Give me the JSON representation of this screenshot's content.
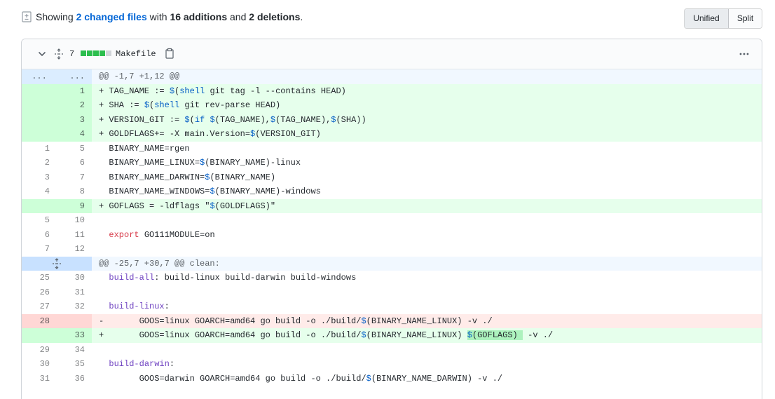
{
  "summary": {
    "showing": "Showing",
    "files_link": "2 changed files",
    "with": "with",
    "additions": "16 additions",
    "and": "and",
    "deletions": "2 deletions",
    "period": "."
  },
  "view_toggle": {
    "unified": "Unified",
    "split": "Split"
  },
  "file": {
    "change_count": "7",
    "name": "Makefile",
    "diffstat": {
      "added_blocks": 4,
      "neutral_blocks": 1
    }
  },
  "hunks": [
    {
      "header": "@@ -1,7 +1,12 @@",
      "left_marker": "...",
      "right_marker": "...",
      "lines": [
        {
          "type": "add",
          "old": "",
          "new": "1",
          "sign": "+",
          "code": "TAG_NAME := $(shell git tag -l --contains HEAD)"
        },
        {
          "type": "add",
          "old": "",
          "new": "2",
          "sign": "+",
          "code": "SHA := $(shell git rev-parse HEAD)"
        },
        {
          "type": "add",
          "old": "",
          "new": "3",
          "sign": "+",
          "code": "VERSION_GIT := $(if $(TAG_NAME),$(TAG_NAME),$(SHA))"
        },
        {
          "type": "add",
          "old": "",
          "new": "4",
          "sign": "+",
          "code": "GOLDFLAGS+= -X main.Version=$(VERSION_GIT)"
        },
        {
          "type": "ctx",
          "old": "1",
          "new": "5",
          "sign": " ",
          "code": "BINARY_NAME=rgen"
        },
        {
          "type": "ctx",
          "old": "2",
          "new": "6",
          "sign": " ",
          "code": "BINARY_NAME_LINUX=$(BINARY_NAME)-linux"
        },
        {
          "type": "ctx",
          "old": "3",
          "new": "7",
          "sign": " ",
          "code": "BINARY_NAME_DARWIN=$(BINARY_NAME)"
        },
        {
          "type": "ctx",
          "old": "4",
          "new": "8",
          "sign": " ",
          "code": "BINARY_NAME_WINDOWS=$(BINARY_NAME)-windows"
        },
        {
          "type": "add",
          "old": "",
          "new": "9",
          "sign": "+",
          "code": "GOFLAGS = -ldflags \"$(GOLDFLAGS)\""
        },
        {
          "type": "ctx",
          "old": "5",
          "new": "10",
          "sign": " ",
          "code": ""
        },
        {
          "type": "ctx",
          "old": "6",
          "new": "11",
          "sign": " ",
          "code": "export GO111MODULE=on"
        },
        {
          "type": "ctx",
          "old": "7",
          "new": "12",
          "sign": " ",
          "code": ""
        }
      ]
    },
    {
      "header": "@@ -25,7 +30,7 @@ clean:",
      "lines": [
        {
          "type": "ctx",
          "old": "25",
          "new": "30",
          "sign": " ",
          "code": "build-all: build-linux build-darwin build-windows"
        },
        {
          "type": "ctx",
          "old": "26",
          "new": "31",
          "sign": " ",
          "code": ""
        },
        {
          "type": "ctx",
          "old": "27",
          "new": "32",
          "sign": " ",
          "code": "build-linux:"
        },
        {
          "type": "del",
          "old": "28",
          "new": "",
          "sign": "-",
          "code": "\tGOOS=linux GOARCH=amd64 go build -o ./build/$(BINARY_NAME_LINUX) -v ./"
        },
        {
          "type": "add",
          "old": "",
          "new": "33",
          "sign": "+",
          "code": "\tGOOS=linux GOARCH=amd64 go build -o ./build/$(BINARY_NAME_LINUX) $(GOFLAGS) -v ./"
        },
        {
          "type": "ctx",
          "old": "29",
          "new": "34",
          "sign": " ",
          "code": ""
        },
        {
          "type": "ctx",
          "old": "30",
          "new": "35",
          "sign": " ",
          "code": "build-darwin:"
        },
        {
          "type": "ctx",
          "old": "31",
          "new": "36",
          "sign": " ",
          "code": "\tGOOS=darwin GOARCH=amd64 go build -o ./build/$(BINARY_NAME_DARWIN) -v ./"
        }
      ]
    }
  ],
  "icons": {
    "summary": "file-diff-icon",
    "collapse": "chevron-down-icon",
    "expand": "unfold-icon",
    "copy": "clipboard-icon",
    "menu": "kebab-horizontal-icon"
  },
  "colors": {
    "link": "#0366d6",
    "add_bg": "#e6ffec",
    "add_num_bg": "#cdffd8",
    "del_bg": "#ffebe9",
    "del_num_bg": "#ffd7d5",
    "hunk_bg": "#f1f8ff",
    "hunk_num_bg": "#c8e1ff",
    "added_word_bg": "#acf2bd"
  }
}
